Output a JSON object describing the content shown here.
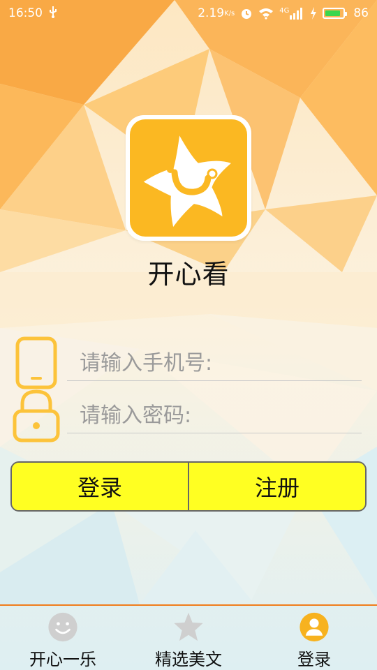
{
  "status_bar": {
    "time": "16:50",
    "speed": "2.19",
    "speed_unit": "K/s",
    "network": "4G",
    "battery": "86",
    "battery_level": 0.86
  },
  "app": {
    "title": "开心看",
    "accent_color": "#fbb822"
  },
  "login_form": {
    "phone_placeholder": "请输入手机号:",
    "phone_value": "",
    "password_placeholder": "请输入密码:",
    "password_value": ""
  },
  "buttons": {
    "login_label": "登录",
    "register_label": "注册",
    "color": "#ffff22"
  },
  "bottom_nav": {
    "items": [
      {
        "label": "开心一乐",
        "icon": "smiley-icon",
        "active": false
      },
      {
        "label": "精选美文",
        "icon": "star-icon",
        "active": false
      },
      {
        "label": "登录",
        "icon": "user-icon",
        "active": true
      }
    ],
    "active_color": "#f7b21f",
    "inactive_color": "#cfcfcf"
  }
}
